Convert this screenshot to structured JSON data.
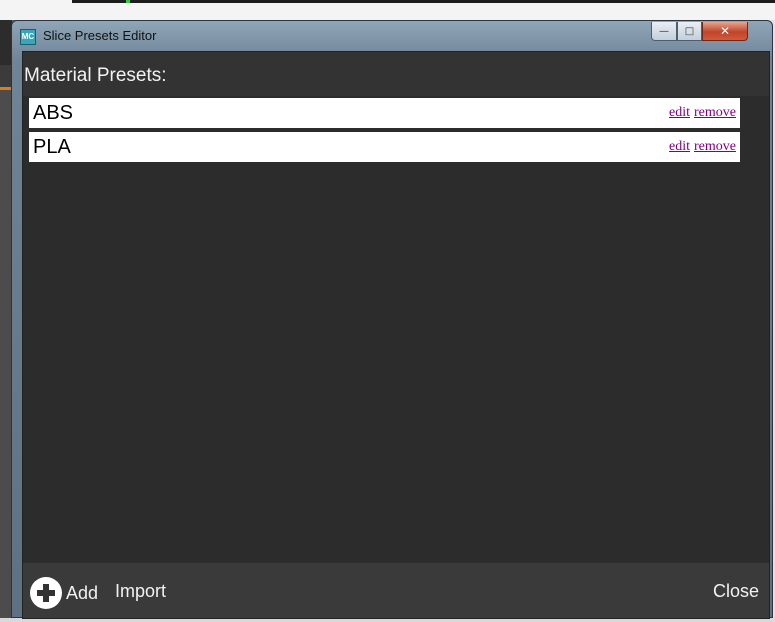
{
  "window": {
    "title": "Slice Presets Editor",
    "icon_label": "MC",
    "controls": {
      "minimize": "—",
      "maximize": "□",
      "close": "✕"
    }
  },
  "dialog": {
    "heading": "Material Presets:",
    "presets": [
      {
        "name": "ABS",
        "edit_label": "edit",
        "remove_label": "remove"
      },
      {
        "name": "PLA",
        "edit_label": "edit",
        "remove_label": "remove"
      }
    ],
    "footer": {
      "add_label": "Add",
      "import_label": "Import",
      "close_label": "Close"
    }
  },
  "colors": {
    "link": "#800080",
    "panel": "#333333",
    "accent": "#e07a1f"
  }
}
